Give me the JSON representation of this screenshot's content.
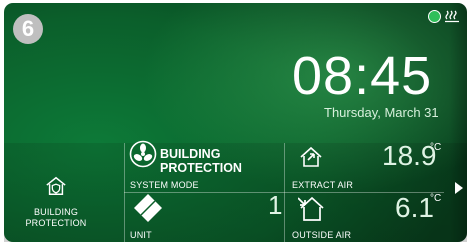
{
  "badge": "6",
  "clock": {
    "time": "08:45",
    "date": "Thursday, March 31"
  },
  "mode": {
    "title": "BUILDING PROTECTION",
    "label": "SYSTEM MODE"
  },
  "building_protection_tile": {
    "label_line1": "BUILDING",
    "label_line2": "PROTECTION"
  },
  "unit": {
    "label": "UNIT",
    "value": "1"
  },
  "extract_air": {
    "label": "EXTRACT AIR",
    "temp": "18.9",
    "unit": "°C"
  },
  "outside_air": {
    "label": "OUTSIDE AIR",
    "temp": "6.1",
    "unit": "°C"
  },
  "colors": {
    "background": "#0b6a31",
    "status_dot": "#2fbf5a",
    "badge": "#bfbfbf"
  },
  "icons": [
    "status-dot-icon",
    "heater-icon",
    "house-shield-icon",
    "fan-icon",
    "diamond-icon",
    "house-arrow-in-icon",
    "house-arrow-out-icon",
    "chevron-right-icon"
  ]
}
